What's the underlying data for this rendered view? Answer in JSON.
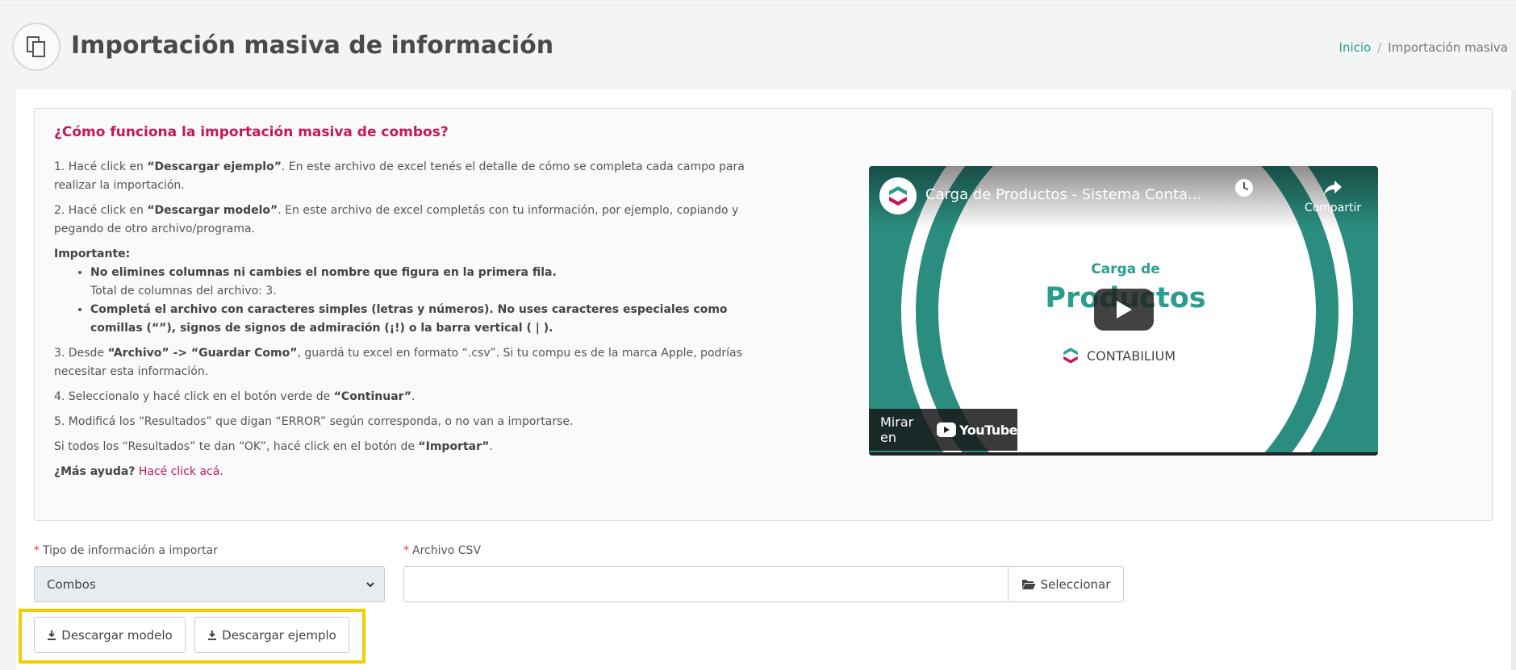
{
  "header": {
    "title": "Importación masiva de información",
    "icon": "copy-icon",
    "breadcrumb": {
      "home": "Inicio",
      "separator": "/",
      "current": "Importación masiva"
    }
  },
  "info": {
    "title": "¿Cómo funciona la importación masiva de combos?",
    "step1_pre": "1. Hacé click en ",
    "step1_bold": "“Descargar ejemplo”",
    "step1_post": ". En este archivo de excel tenés el detalle de cómo se completa cada campo para realizar la importación.",
    "step2_pre": "2. Hacé click en ",
    "step2_bold": "“Descargar modelo”",
    "step2_post": ". En este archivo de excel completás con tu información, por ejemplo, copiando y pegando de otro archivo/programa.",
    "important_label": "Importante:",
    "bullet1_bold": "No elimines columnas ni cambies el nombre que figura en la primera fila.",
    "bullet1_sub": "Total de columnas del archivo: 3.",
    "bullet2_bold": "Completá el archivo con caracteres simples (letras y números). No uses caracteres especiales como comillas (“”), signos de signos de admiración (¡!) o la barra vertical ( | ).",
    "step3_pre": "3. Desde ",
    "step3_bold": "“Archivo” -> “Guardar Como”",
    "step3_post": ", guardá tu excel en formato “.csv”. Si tu compu es de la marca Apple, podrías necesitar esta información.",
    "step4_pre": "4. Seleccionalo y hacé click en el botón verde de ",
    "step4_bold": "“Continuar”",
    "step4_post": ".",
    "step5": "5. Modificá los “Resultados” que digan “ERROR” según corresponda, o no van a importarse.",
    "ok_pre": "Si todos los “Resultados” te dan “OK”, hacé click en el botón de ",
    "ok_bold": "“Importar”",
    "ok_post": ".",
    "help_bold": "¿Más ayuda?",
    "help_link": "Hacé click acá."
  },
  "video": {
    "title": "Carga de Productos - Sistema Conta...",
    "watch_later": "Ver más ta...",
    "share": "Compartir",
    "center_line1": "Carga de",
    "center_line2": "Productos",
    "brand": "CONTABILIUM",
    "watch_on": "Mirar en",
    "youtube": "YouTube"
  },
  "form": {
    "type_label": "Tipo de información a importar",
    "type_value": "Combos",
    "csv_label": "Archivo CSV",
    "select_button": "Seleccionar",
    "required_mark": "*"
  },
  "actions": {
    "download_model": "Descargar modelo",
    "download_example": "Descargar ejemplo"
  },
  "colors": {
    "accent": "#c2185b",
    "teal": "#2a9d8f",
    "highlight": "#f2cc00"
  }
}
